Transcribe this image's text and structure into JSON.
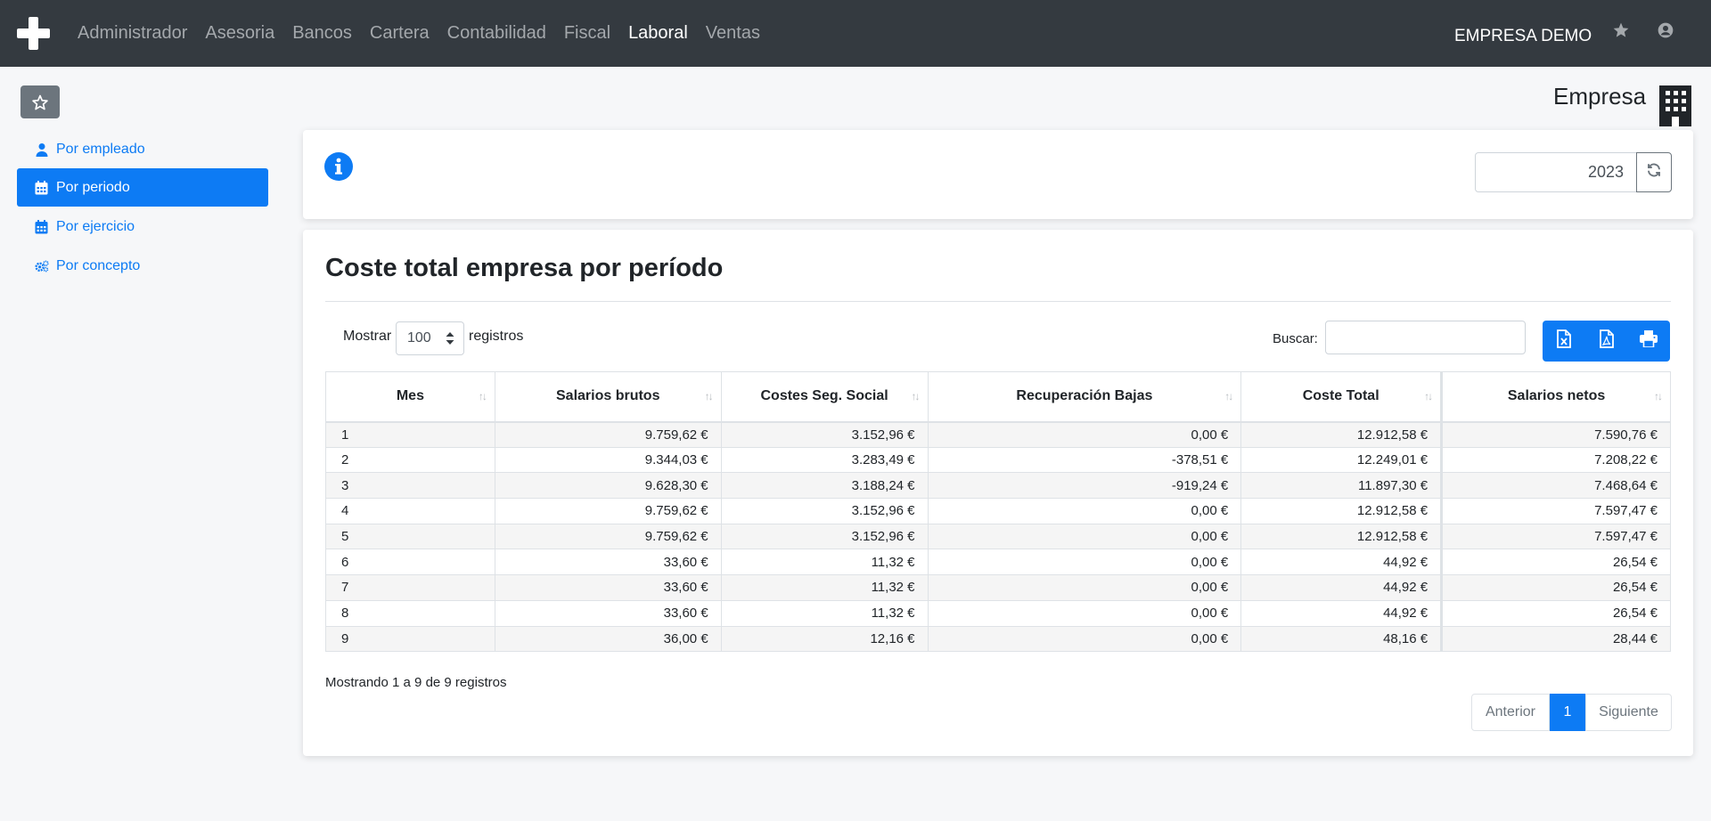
{
  "navbar": {
    "menu": [
      {
        "label": "Administrador",
        "active": false
      },
      {
        "label": "Asesoria",
        "active": false
      },
      {
        "label": "Bancos",
        "active": false
      },
      {
        "label": "Cartera",
        "active": false
      },
      {
        "label": "Contabilidad",
        "active": false
      },
      {
        "label": "Fiscal",
        "active": false
      },
      {
        "label": "Laboral",
        "active": true
      },
      {
        "label": "Ventas",
        "active": false
      }
    ],
    "company": "EMPRESA DEMO",
    "icons": [
      "plus-logo-icon",
      "star-icon",
      "user-circle-icon"
    ]
  },
  "sidebar": {
    "items": [
      {
        "label": "Por empleado",
        "icon": "user-icon",
        "active": false
      },
      {
        "label": "Por periodo",
        "icon": "calendar-icon",
        "active": true
      },
      {
        "label": "Por ejercicio",
        "icon": "calendar-icon",
        "active": false
      },
      {
        "label": "Por concepto",
        "icon": "cogs-icon",
        "active": false
      }
    ]
  },
  "header": {
    "title": "Empresa"
  },
  "filter": {
    "year": "2023"
  },
  "main": {
    "title": "Coste total empresa por período",
    "length": {
      "prefix": "Mostrar",
      "value": "100",
      "suffix": "registros"
    },
    "search": {
      "label": "Buscar:",
      "value": ""
    },
    "table": {
      "columns": [
        "Mes",
        "Salarios brutos",
        "Costes Seg. Social",
        "Recuperación Bajas",
        "Coste Total",
        "Salarios netos"
      ],
      "rows": [
        [
          "1",
          "9.759,62 €",
          "3.152,96 €",
          "0,00 €",
          "12.912,58 €",
          "7.590,76 €"
        ],
        [
          "2",
          "9.344,03 €",
          "3.283,49 €",
          "-378,51 €",
          "12.249,01 €",
          "7.208,22 €"
        ],
        [
          "3",
          "9.628,30 €",
          "3.188,24 €",
          "-919,24 €",
          "11.897,30 €",
          "7.468,64 €"
        ],
        [
          "4",
          "9.759,62 €",
          "3.152,96 €",
          "0,00 €",
          "12.912,58 €",
          "7.597,47 €"
        ],
        [
          "5",
          "9.759,62 €",
          "3.152,96 €",
          "0,00 €",
          "12.912,58 €",
          "7.597,47 €"
        ],
        [
          "6",
          "33,60 €",
          "11,32 €",
          "0,00 €",
          "44,92 €",
          "26,54 €"
        ],
        [
          "7",
          "33,60 €",
          "11,32 €",
          "0,00 €",
          "44,92 €",
          "26,54 €"
        ],
        [
          "8",
          "33,60 €",
          "11,32 €",
          "0,00 €",
          "44,92 €",
          "26,54 €"
        ],
        [
          "9",
          "36,00 €",
          "12,16 €",
          "0,00 €",
          "48,16 €",
          "28,44 €"
        ]
      ]
    },
    "info": "Mostrando 1 a 9 de 9 registros",
    "pagination": {
      "prev": "Anterior",
      "current": "1",
      "next": "Siguiente"
    }
  },
  "colors": {
    "primary": "#0d7bf4",
    "navbar": "#343a40",
    "secondary": "#6c757d"
  }
}
